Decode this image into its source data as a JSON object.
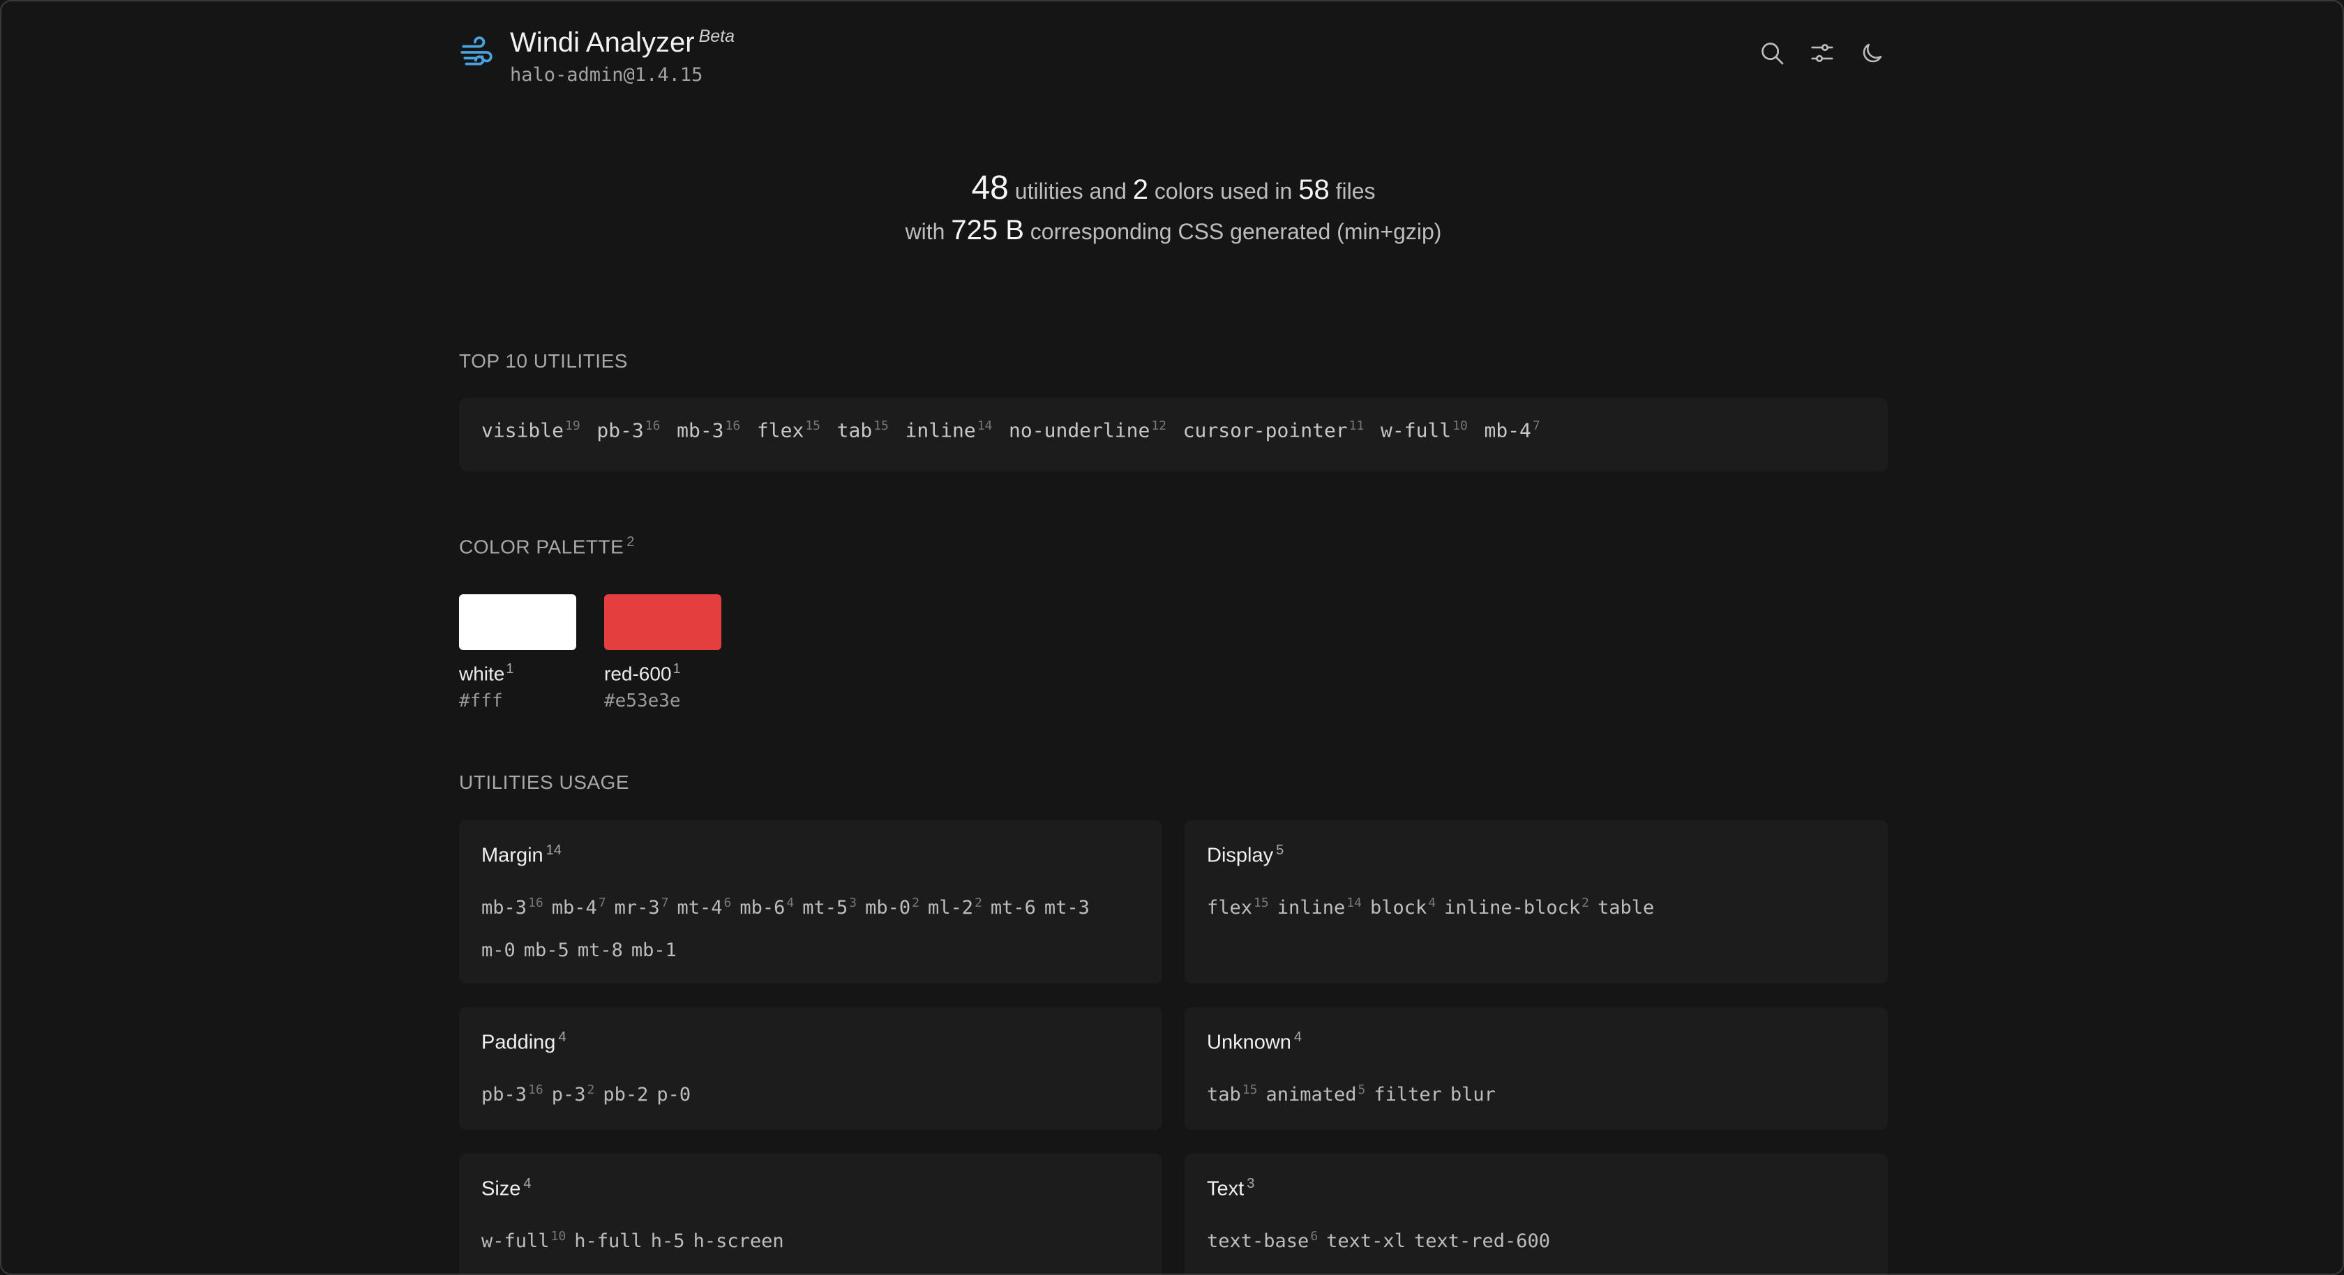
{
  "header": {
    "title": "Windi Analyzer",
    "beta": "Beta",
    "project": "halo-admin@1.4.15",
    "icons": [
      "wind-logo-icon",
      "search-icon",
      "sliders-icon",
      "moon-icon"
    ]
  },
  "summary": {
    "utilities_count": "48",
    "utilities_text": "utilities and",
    "colors_count": "2",
    "colors_text": "colors used in",
    "files_count": "58",
    "files_text": "files",
    "with_text": "with",
    "css_size": "725 B",
    "css_text": "corresponding CSS generated (min+gzip)"
  },
  "top_utilities": {
    "title": "TOP 10 UTILITIES",
    "items": [
      {
        "name": "visible",
        "count": "19"
      },
      {
        "name": "pb-3",
        "count": "16"
      },
      {
        "name": "mb-3",
        "count": "16"
      },
      {
        "name": "flex",
        "count": "15"
      },
      {
        "name": "tab",
        "count": "15"
      },
      {
        "name": "inline",
        "count": "14"
      },
      {
        "name": "no-underline",
        "count": "12"
      },
      {
        "name": "cursor-pointer",
        "count": "11"
      },
      {
        "name": "w-full",
        "count": "10"
      },
      {
        "name": "mb-4",
        "count": "7"
      }
    ]
  },
  "palette": {
    "title": "COLOR PALETTE",
    "count": "2",
    "colors": [
      {
        "name": "white",
        "count": "1",
        "hex": "#fff",
        "swatch": "#ffffff"
      },
      {
        "name": "red-600",
        "count": "1",
        "hex": "#e53e3e",
        "swatch": "#e53e3e"
      }
    ]
  },
  "usage": {
    "title": "UTILITIES USAGE",
    "cards": [
      {
        "title": "Margin",
        "count": "14",
        "items": [
          {
            "name": "mb-3",
            "count": "16"
          },
          {
            "name": "mb-4",
            "count": "7"
          },
          {
            "name": "mr-3",
            "count": "7"
          },
          {
            "name": "mt-4",
            "count": "6"
          },
          {
            "name": "mb-6",
            "count": "4"
          },
          {
            "name": "mt-5",
            "count": "3"
          },
          {
            "name": "mb-0",
            "count": "2"
          },
          {
            "name": "ml-2",
            "count": "2"
          },
          {
            "name": "mt-6",
            "count": ""
          },
          {
            "name": "mt-3",
            "count": ""
          },
          {
            "name": "m-0",
            "count": ""
          },
          {
            "name": "mb-5",
            "count": ""
          },
          {
            "name": "mt-8",
            "count": ""
          },
          {
            "name": "mb-1",
            "count": ""
          }
        ]
      },
      {
        "title": "Display",
        "count": "5",
        "items": [
          {
            "name": "flex",
            "count": "15"
          },
          {
            "name": "inline",
            "count": "14"
          },
          {
            "name": "block",
            "count": "4"
          },
          {
            "name": "inline-block",
            "count": "2"
          },
          {
            "name": "table",
            "count": ""
          }
        ]
      },
      {
        "title": "Padding",
        "count": "4",
        "items": [
          {
            "name": "pb-3",
            "count": "16"
          },
          {
            "name": "p-3",
            "count": "2"
          },
          {
            "name": "pb-2",
            "count": ""
          },
          {
            "name": "p-0",
            "count": ""
          }
        ]
      },
      {
        "title": "Unknown",
        "count": "4",
        "items": [
          {
            "name": "tab",
            "count": "15"
          },
          {
            "name": "animated",
            "count": "5"
          },
          {
            "name": "filter",
            "count": ""
          },
          {
            "name": "blur",
            "count": ""
          }
        ]
      },
      {
        "title": "Size",
        "count": "4",
        "items": [
          {
            "name": "w-full",
            "count": "10"
          },
          {
            "name": "h-full",
            "count": ""
          },
          {
            "name": "h-5",
            "count": ""
          },
          {
            "name": "h-screen",
            "count": ""
          }
        ]
      },
      {
        "title": "Text",
        "count": "3",
        "items": [
          {
            "name": "text-base",
            "count": "6"
          },
          {
            "name": "text-xl",
            "count": ""
          },
          {
            "name": "text-red-600",
            "count": ""
          }
        ]
      }
    ]
  }
}
